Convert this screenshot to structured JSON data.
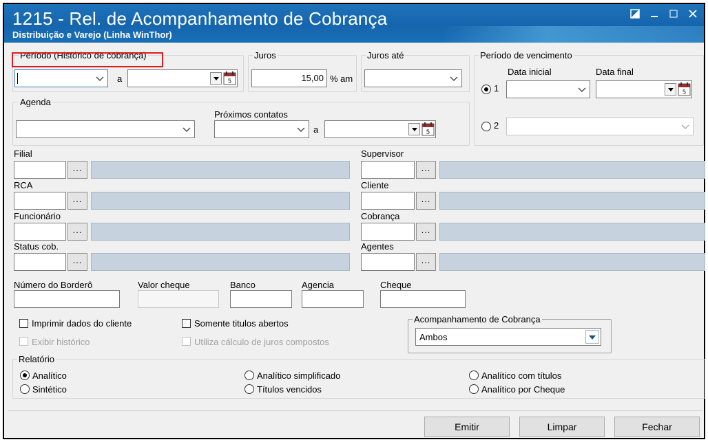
{
  "window": {
    "title": "1215 - Rel. de Acompanhamento de Cobrança",
    "subtitle": "Distribuição e Varejo (Linha WinThor)"
  },
  "periodo_historico": {
    "label": "Período (Histórico de cobrança)",
    "separator": "a"
  },
  "juros": {
    "label": "Juros",
    "value": "15,00",
    "unit": "% am"
  },
  "juros_ate": {
    "label": "Juros até"
  },
  "periodo_vencimento": {
    "label": "Período de vencimento",
    "data_inicial_label": "Data inicial",
    "data_final_label": "Data final",
    "option1": "1",
    "option2": "2"
  },
  "agenda": {
    "label": "Agenda",
    "proximos_label": "Próximos contatos",
    "separator": "a"
  },
  "lookups": {
    "filial": "Filial",
    "supervisor": "Supervisor",
    "rca": "RCA",
    "cliente": "Cliente",
    "funcionario": "Funcionário",
    "cobranca": "Cobrança",
    "status": "Status cob.",
    "agentes": "Agentes",
    "ellipsis": "..."
  },
  "fields": {
    "bordero": "Número do Borderô",
    "valor_cheque": "Valor cheque",
    "banco": "Banco",
    "agencia": "Agencia",
    "cheque": "Cheque"
  },
  "checks": {
    "imprimir": "Imprimir dados do cliente",
    "exibir": "Exibir histórico",
    "somente": "Somente titulos abertos",
    "utiliza": "Utiliza cálculo de juros compostos"
  },
  "acompanhamento": {
    "label": "Acompanhamento de Cobrança",
    "value": "Ambos"
  },
  "relatorio": {
    "label": "Relatório",
    "analitico": "Analítico",
    "sintetico": "Sintético",
    "analitico_simplificado": "Analítico simplificado",
    "titulos_vencidos": "Títulos vencidos",
    "analitico_titulos": "Analítico com títulos",
    "analitico_cheque": "Analítico por Cheque"
  },
  "buttons": {
    "emitir": "Emitir",
    "limpar": "Limpar",
    "fechar": "Fechar"
  },
  "colors": {
    "title_bar": "#1565ad",
    "highlight": "#e01b1b",
    "lookup_fill": "#c6d3de"
  }
}
